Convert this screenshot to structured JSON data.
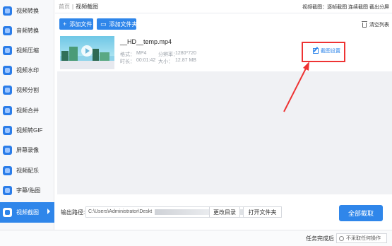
{
  "sidebar": {
    "items": [
      {
        "label": "视频转换",
        "icon": "video-convert-icon"
      },
      {
        "label": "音频转换",
        "icon": "audio-convert-icon"
      },
      {
        "label": "视频压缩",
        "icon": "video-compress-icon"
      },
      {
        "label": "视频水印",
        "icon": "video-watermark-icon"
      },
      {
        "label": "视频分割",
        "icon": "video-split-icon"
      },
      {
        "label": "视频合并",
        "icon": "video-merge-icon"
      },
      {
        "label": "视频转GIF",
        "icon": "video-gif-icon"
      },
      {
        "label": "屏幕录像",
        "icon": "screen-record-icon"
      },
      {
        "label": "视频配乐",
        "icon": "video-music-icon"
      },
      {
        "label": "字幕/贴图",
        "icon": "subtitle-icon"
      },
      {
        "label": "视频截图",
        "icon": "video-screenshot-icon",
        "active": true
      }
    ]
  },
  "breadcrumb": {
    "home": "首页",
    "separator": "|",
    "current": "视频截图"
  },
  "topbar_right": "视频截图：逐帧截图 连续截图 截出分屏",
  "toolbar": {
    "add_file": "添加文件",
    "add_folder": "添加文件夹",
    "clear_list": "清空列表"
  },
  "file": {
    "name": "__HD__temp.mp4",
    "format_label": "格式：",
    "format": "MP4",
    "resolution_label": "分辨率：",
    "resolution": "1280*720",
    "duration_label": "时长：",
    "duration": "00:01:42",
    "size_label": "大小：",
    "size": "12.87 MB",
    "settings_link": "截图设置"
  },
  "bottom": {
    "output_label": "输出路径:",
    "output_path": "C:\\Users\\Administrator\\Deskt",
    "change_dir": "更改目录",
    "open_folder": "打开文件夹",
    "start": "全部截取"
  },
  "status": {
    "label": "任务完成后",
    "select_value": "不采取任何操作"
  },
  "colors": {
    "accent": "#2f86ea",
    "annotation": "#ee3333"
  }
}
